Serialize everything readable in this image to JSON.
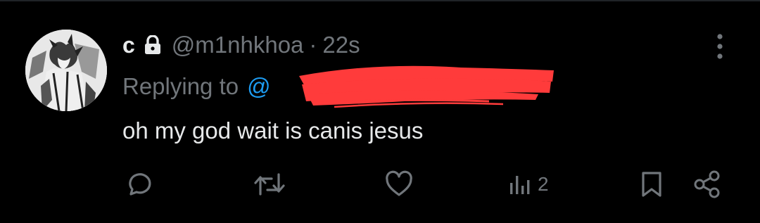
{
  "tweet": {
    "display_name": "c",
    "handle": "@m1nhkhoa",
    "separator": "·",
    "time_ago": "22s",
    "replying_label": "Replying to",
    "reply_handle_visible": "@",
    "text": "oh my god wait is canis jesus"
  },
  "actions": {
    "reply_icon": "speech-bubble-icon",
    "retweet_icon": "retweet-arrows-icon",
    "like_icon": "heart-icon",
    "views_icon": "bar-chart-icon",
    "views_count": "2",
    "bookmark_icon": "bookmark-icon",
    "share_icon": "share-icon"
  },
  "colors": {
    "background": "#000000",
    "primary_text": "#e7e9ea",
    "secondary_text": "#71767b",
    "link": "#1d9bf0",
    "redaction": "#ff3b3b"
  }
}
